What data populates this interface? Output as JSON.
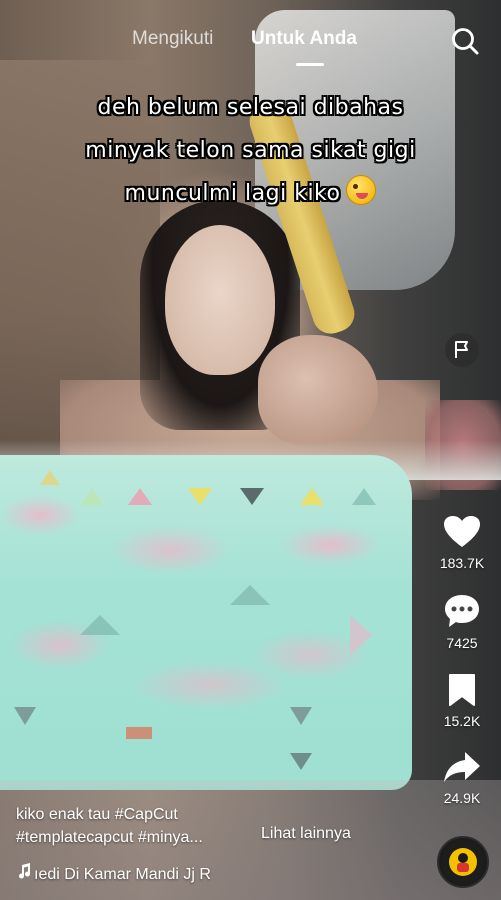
{
  "nav": {
    "tab_following": "Mengikuti",
    "tab_foryou": "Untuk Anda",
    "search_icon": "search-icon"
  },
  "caption": {
    "line1": "deh belum selesai dibahas",
    "line2": "minyak telon sama sikat gigi",
    "line3": "munculmi lagi kiko"
  },
  "actions": {
    "likes": "183.7K",
    "comments": "7425",
    "bookmarks": "15.2K",
    "shares": "24.9K"
  },
  "post": {
    "desc_line1": "kiko enak tau  #CapCut",
    "desc_line2": "#templatecapcut #minya...",
    "more_label": "Lihat lainnya",
    "music": "ıedi Di Kamar Mandi Jj R"
  },
  "colors": {
    "accent_white": "#ffffff",
    "mosaic": "#a4e2d5"
  }
}
